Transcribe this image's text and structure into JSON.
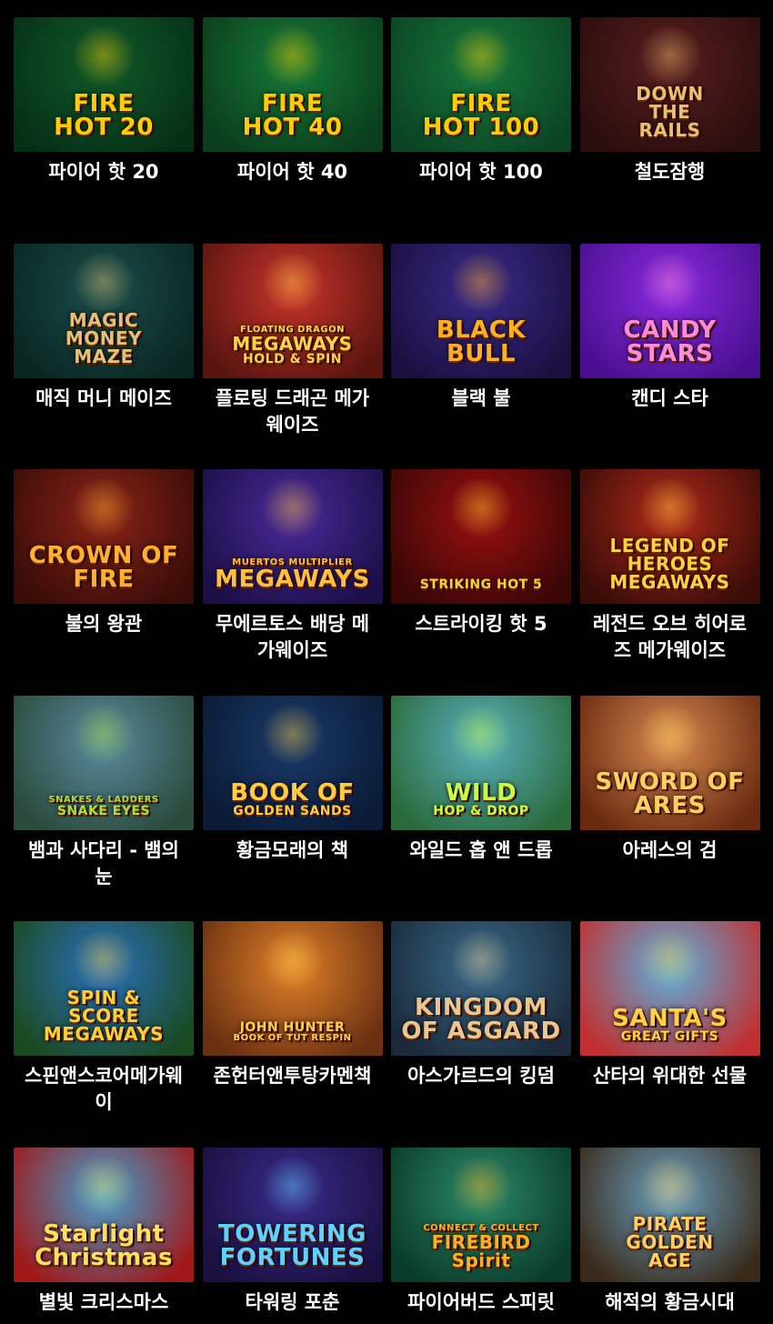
{
  "games": [
    {
      "title": "파이어 핫 20",
      "logo": [
        "FIRE",
        "HOT 20"
      ],
      "bg": [
        "#0f5a2a",
        "#063016"
      ],
      "accent": "#ffcc00"
    },
    {
      "title": "파이어 핫 40",
      "logo": [
        "FIRE",
        "HOT 40"
      ],
      "bg": [
        "#167a38",
        "#0a3d1c"
      ],
      "accent": "#ffcc00"
    },
    {
      "title": "파이어 핫 100",
      "logo": [
        "FIRE",
        "HOT 100"
      ],
      "bg": [
        "#16783b",
        "#0b4424"
      ],
      "accent": "#ffcc00"
    },
    {
      "title": "철도잠행",
      "logo": [
        "DOWN",
        "THE",
        "RAILS"
      ],
      "bg": [
        "#5a1f1f",
        "#2a0d0d"
      ],
      "accent": "#e8c070"
    },
    {
      "title": "매직 머니 메이즈",
      "logo": [
        "MAGIC",
        "MONEY",
        "MAZE"
      ],
      "bg": [
        "#1b4d4a",
        "#0a2624"
      ],
      "accent": "#e2c27a"
    },
    {
      "title": "플로팅 드래곤 메가웨이즈",
      "logo": [
        "FLOATING DRAGON",
        "MEGAWAYS",
        "HOLD & SPIN"
      ],
      "bg": [
        "#c8342a",
        "#5a1410"
      ],
      "accent": "#ffd24a"
    },
    {
      "title": "블랙 불",
      "logo": [
        "BLACK",
        "BULL"
      ],
      "bg": [
        "#3a2a8a",
        "#1a1040"
      ],
      "accent": "#ffb020"
    },
    {
      "title": "캔디 스타",
      "logo": [
        "CANDY",
        "STARS"
      ],
      "bg": [
        "#8a2ae0",
        "#4a0f90"
      ],
      "accent": "#ff8ad8"
    },
    {
      "title": "불의 왕관",
      "logo": [
        "CROWN OF",
        "FIRE"
      ],
      "bg": [
        "#8a2418",
        "#3a0c08"
      ],
      "accent": "#ffb030"
    },
    {
      "title": "무에르토스 배당 메가웨이즈",
      "logo": [
        "MUERTOS MULTIPLIER",
        "MEGAWAYS"
      ],
      "bg": [
        "#4a2a9a",
        "#1c0f48"
      ],
      "accent": "#ffc040"
    },
    {
      "title": "스트라이킹 핫 5",
      "logo": [
        "STRIKING HOT 5"
      ],
      "bg": [
        "#9a1010",
        "#3a0606"
      ],
      "accent": "#ffd030"
    },
    {
      "title": "레전드 오브 히어로즈 메가웨이즈",
      "logo": [
        "LEGEND OF",
        "HEROES",
        "MEGAWAYS"
      ],
      "bg": [
        "#b02a1a",
        "#3a0c08"
      ],
      "accent": "#ffd040"
    },
    {
      "title": "뱀과 사다리 - 뱀의 눈",
      "logo": [
        "SNAKES & LADDERS",
        "SNAKE EYES"
      ],
      "bg": [
        "#5a8aa0",
        "#2a4a3a"
      ],
      "accent": "#aadf40"
    },
    {
      "title": "황금모래의 책",
      "logo": [
        "BOOK OF",
        "GOLDEN SANDS"
      ],
      "bg": [
        "#1a3a6a",
        "#0a1a34"
      ],
      "accent": "#ffcc40"
    },
    {
      "title": "와일드 홉 앤 드롭",
      "logo": [
        "WILD",
        "HOP & DROP"
      ],
      "bg": [
        "#5ab0c0",
        "#2a6a3a"
      ],
      "accent": "#c8ff40"
    },
    {
      "title": "아레스의 검",
      "logo": [
        "SWORD OF",
        "ARES"
      ],
      "bg": [
        "#d88a50",
        "#6a2a10"
      ],
      "accent": "#ffd060"
    },
    {
      "title": "스핀앤스코어메가웨이",
      "logo": [
        "SPIN &",
        "SCORE",
        "MEGAWAYS"
      ],
      "bg": [
        "#2a70c0",
        "#1a4a20"
      ],
      "accent": "#ffd030"
    },
    {
      "title": "존헌터앤투탕카멘책",
      "logo": [
        "JOHN HUNTER",
        "BOOK OF TUT RESPIN"
      ],
      "bg": [
        "#e0802a",
        "#6a3010"
      ],
      "accent": "#ffd050"
    },
    {
      "title": "아스가르드의 킹덤",
      "logo": [
        "KINGDOM",
        "OF ASGARD"
      ],
      "bg": [
        "#3a6a8a",
        "#1a2a3a"
      ],
      "accent": "#e8c890"
    },
    {
      "title": "산타의 위대한 선물",
      "logo": [
        "SANTA'S",
        "GREAT GIFTS"
      ],
      "bg": [
        "#5ab0e0",
        "#c03030"
      ],
      "accent": "#ffd040"
    },
    {
      "title": "별빛 크리스마스",
      "logo": [
        "Starlight",
        "Christmas"
      ],
      "bg": [
        "#40a0d0",
        "#a01818"
      ],
      "accent": "#ffe060"
    },
    {
      "title": "타워링 포춘",
      "logo": [
        "TOWERING",
        "FORTUNES"
      ],
      "bg": [
        "#3a2a8a",
        "#1a1040"
      ],
      "accent": "#60d0ff"
    },
    {
      "title": "파이어버드 스피릿",
      "logo": [
        "CONNECT & COLLECT",
        "FIREBIRD",
        "Spirit"
      ],
      "bg": [
        "#2a8a6a",
        "#0a3a2a"
      ],
      "accent": "#ffb020"
    },
    {
      "title": "해적의 황금시대",
      "logo": [
        "PIRATE",
        "GOLDEN",
        "AGE"
      ],
      "bg": [
        "#6aa0c0",
        "#3a2a1a"
      ],
      "accent": "#ffd060"
    }
  ]
}
